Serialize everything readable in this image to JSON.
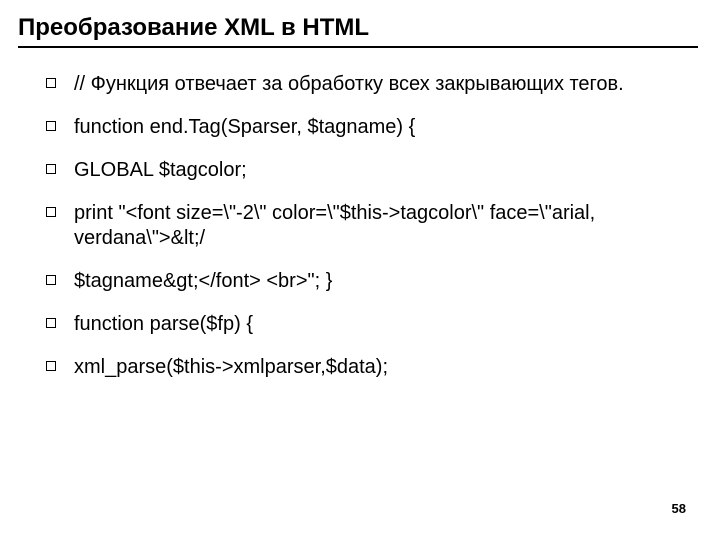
{
  "title": "Преобразование XML в HTML",
  "bullets": [
    "// Функция отвечает за обработку всех закрывающих тегов.",
    "function end.Tag(Sparser, $tagname) {",
    "GLOBAL $tagcolor;",
    "print \"<font size=\\\"-2\\\" color=\\\"$this->tagcolor\\\" face=\\\"arial, verdana\\\">&lt;/",
    "$tagname&gt;</font> <br>\"; }",
    "function parse($fp) {",
    "xml_parse($this->xmlparser,$data);"
  ],
  "page_number": "58"
}
